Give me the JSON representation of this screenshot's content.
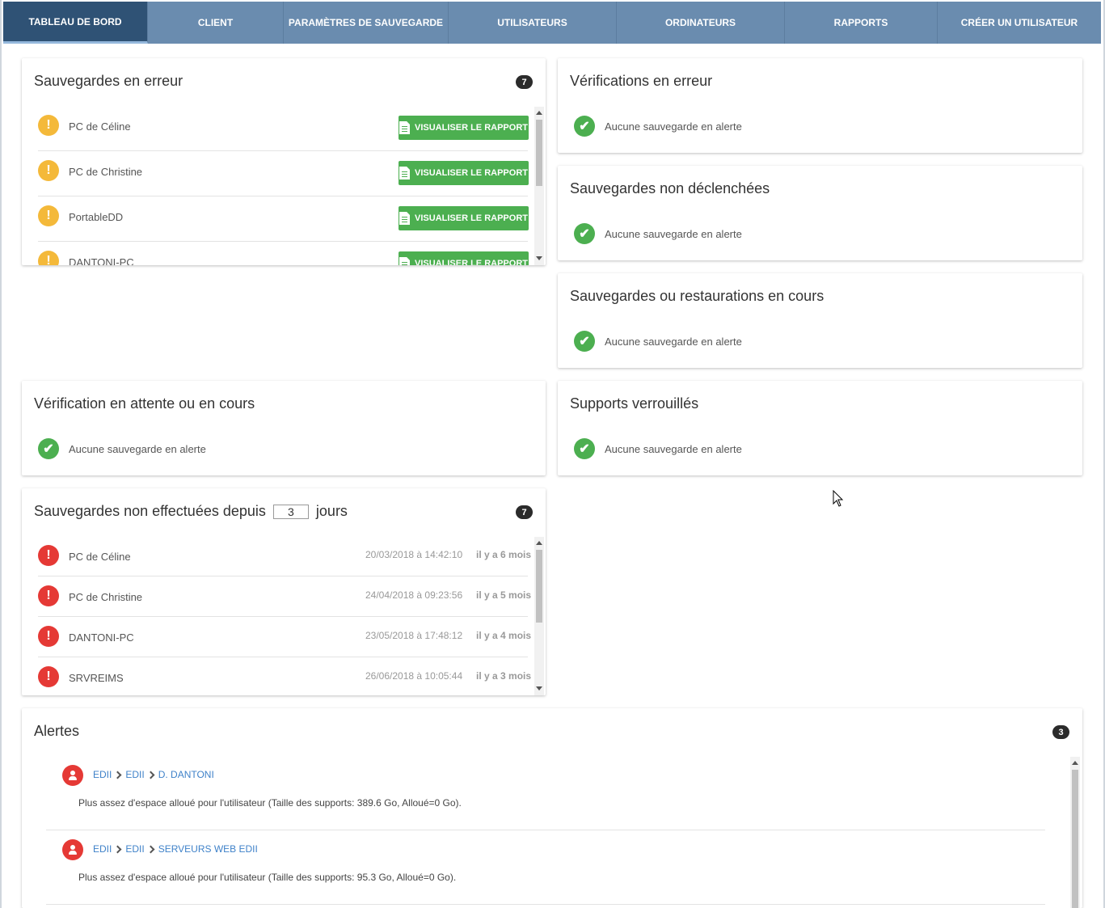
{
  "nav": {
    "tabs": [
      {
        "label": "TABLEAU DE BORD"
      },
      {
        "label": "CLIENT"
      },
      {
        "label": "PARAMÈTRES DE SAUVEGARDE"
      },
      {
        "label": "UTILISATEURS"
      },
      {
        "label": "ORDINATEURS"
      },
      {
        "label": "RAPPORTS"
      },
      {
        "label": "CRÉER UN UTILISATEUR"
      }
    ]
  },
  "backup_errors": {
    "title": "Sauvegardes en erreur",
    "count": "7",
    "button_label": "VISUALISER LE RAPPORT",
    "items": [
      {
        "name": "PC de Céline"
      },
      {
        "name": "PC de Christine"
      },
      {
        "name": "PortableDD"
      },
      {
        "name": "DANTONI-PC"
      }
    ]
  },
  "verification_errors": {
    "title": "Vérifications en erreur",
    "message": "Aucune sauvegarde en alerte"
  },
  "not_triggered": {
    "title": "Sauvegardes non déclenchées",
    "message": "Aucune sauvegarde en alerte"
  },
  "in_progress": {
    "title": "Sauvegardes ou restaurations en cours",
    "message": "Aucune sauvegarde en alerte"
  },
  "verification_pending": {
    "title": "Vérification en attente ou en cours",
    "message": "Aucune sauvegarde en alerte"
  },
  "locked_media": {
    "title": "Supports verrouillés",
    "message": "Aucune sauvegarde en alerte"
  },
  "not_done": {
    "title_prefix": "Sauvegardes non effectuées depuis",
    "days": "3",
    "title_suffix": "jours",
    "count": "7",
    "items": [
      {
        "name": "PC de Céline",
        "date": "20/03/2018 à 14:42:10",
        "ago": "il y a 6 mois"
      },
      {
        "name": "PC de Christine",
        "date": "24/04/2018 à 09:23:56",
        "ago": "il y a 5 mois"
      },
      {
        "name": "DANTONI-PC",
        "date": "23/05/2018 à 17:48:12",
        "ago": "il y a 4 mois"
      },
      {
        "name": "SRVREIMS",
        "date": "26/06/2018 à 10:05:44",
        "ago": "il y a 3 mois"
      }
    ]
  },
  "alerts": {
    "title": "Alertes",
    "count": "3",
    "items": [
      {
        "path": [
          "EDII",
          "EDII",
          "D. DANTONI"
        ],
        "message": "Plus assez d'espace alloué pour l'utilisateur (Taille des supports: 389.6 Go, Alloué=0 Go)."
      },
      {
        "path": [
          "EDII",
          "EDII",
          "SERVEURS WEB EDII"
        ],
        "message": "Plus assez d'espace alloué pour l'utilisateur (Taille des supports: 95.3 Go, Alloué=0 Go)."
      }
    ]
  },
  "colors": {
    "nav": "#6a8caf",
    "nav_active": "#2f5275",
    "success": "#4caf50",
    "warning": "#f4b93a",
    "error": "#e53935",
    "link": "#3f82c9"
  },
  "icons": {
    "warning": "exclamation-icon",
    "error": "exclamation-icon",
    "ok": "check-icon",
    "report": "document-icon",
    "user": "user-icon"
  }
}
